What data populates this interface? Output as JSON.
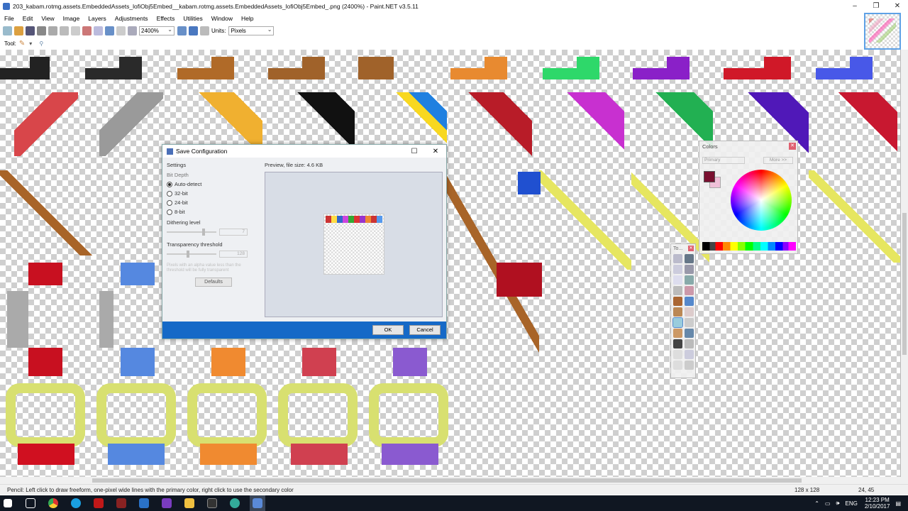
{
  "window": {
    "title": "203_kabam.rotmg.assets.EmbeddedAssets_lofiObj5Embed__kabam.rotmg.assets.EmbeddedAssets_lofiObj5Embed_.png (2400%) - Paint.NET v3.5.11",
    "min": "–",
    "max": "❐",
    "close": "✕"
  },
  "menu": [
    "File",
    "Edit",
    "View",
    "Image",
    "Layers",
    "Adjustments",
    "Effects",
    "Utilities",
    "Window",
    "Help"
  ],
  "toolbar": {
    "zoom": "2400%",
    "units_label": "Units:",
    "units_value": "Pixels"
  },
  "toolrow": {
    "label": "Tool:"
  },
  "dialog": {
    "title": "Save Configuration",
    "settings_label": "Settings",
    "bit_depth_label": "Bit Depth",
    "options": [
      "Auto-detect",
      "32-bit",
      "24-bit",
      "8-bit"
    ],
    "dithering_label": "Dithering level",
    "dithering_value": "7",
    "transparency_label": "Transparency threshold",
    "transparency_value": "128",
    "note": "Pixels with an alpha value less than the threshold will be fully transparent",
    "defaults_label": "Defaults",
    "preview_label": "Preview, file size: 4.6 KB",
    "ok_label": "OK",
    "cancel_label": "Cancel"
  },
  "colors_panel": {
    "title": "Colors",
    "primary_select": "Primary",
    "more_label": "More >>",
    "primary_color": "#7a1030",
    "secondary_color": "#f0c0d8"
  },
  "tools_panel": {
    "title": "To..."
  },
  "status": {
    "message": "Pencil: Left click to draw freeform, one-pixel wide lines with the primary color, right click to use the secondary color",
    "size": "128 x 128",
    "position": "24, 45"
  },
  "taskbar": {
    "lang": "ENG",
    "time": "12:23 PM",
    "date": "2/10/2017"
  }
}
